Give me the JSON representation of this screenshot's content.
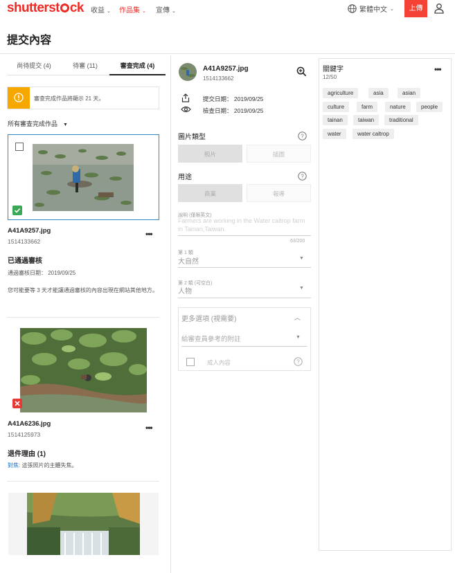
{
  "topbar": {
    "logo": {
      "part1": "shutterst",
      "part2": "ck"
    },
    "nav": [
      {
        "label": "收益",
        "active": false
      },
      {
        "label": "作品集",
        "active": true
      },
      {
        "label": "宣傳",
        "active": false
      }
    ],
    "language": "繁體中文",
    "upload_label": "上傳",
    "colors": {
      "brand": "#ee2b24",
      "upload": "#f44336"
    }
  },
  "page": {
    "title": "提交內容"
  },
  "left": {
    "tabs": [
      {
        "label": "尚待提交 (4)"
      },
      {
        "label": "待審 (11)"
      },
      {
        "label": "審查完成 (4)"
      }
    ],
    "notice": "審查完成作品將顯示 21 天。",
    "filter_label": "所有審查完成作品",
    "items": [
      {
        "filename": "A41A9257.jpg",
        "id": "1514133662",
        "status_title": "已通過審核",
        "approval_date": "通過審核日期： 2019/09/25",
        "note": "您可能要等 3 天才能讓通過審核的內容出現在網站其他地方。"
      },
      {
        "filename": "A41A6236.jpg",
        "id": "1514125973",
        "status_title": "退件理由 (1)",
        "reason_link": "對焦",
        "reason_text": ": 這張照片的主體失焦。"
      }
    ]
  },
  "middle": {
    "filename": "A41A9257.jpg",
    "id": "1514133662",
    "submit_date": "提交日期： 2019/09/25",
    "review_date": "檢查日期： 2019/09/25",
    "image_type": {
      "label": "圖片類型",
      "options": [
        "照片",
        "插圖"
      ]
    },
    "usage": {
      "label": "用途",
      "options": [
        "商業",
        "報導"
      ]
    },
    "description": {
      "label": "說明 (僅限英文)",
      "value": "Farmers are working in the Water caltrop farm in Tainan,Taiwan.",
      "counter": "63/200"
    },
    "category1": {
      "label": "第 1 類",
      "value": "大自然"
    },
    "category2": {
      "label": "第 2 類 (可空白)",
      "value": "人物"
    },
    "more_options": {
      "title": "更多選項 (視需要)",
      "note_placeholder": "給審查員參考的附註",
      "adult_label": "成人內容"
    }
  },
  "keywords": {
    "title": "關鍵字",
    "count": "12/50",
    "items": [
      "agriculture",
      "asia",
      "asian",
      "culture",
      "farm",
      "nature",
      "people",
      "tainan",
      "taiwan",
      "traditional",
      "water",
      "water caltrop"
    ]
  }
}
